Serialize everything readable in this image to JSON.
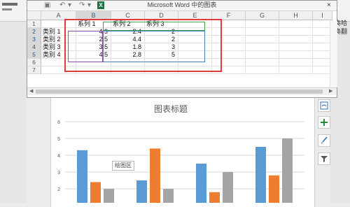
{
  "window": {
    "title": "Microsoft Word 中的图表",
    "close_glyph": "×",
    "qa_save": "▣",
    "qa_undo": "↶",
    "qa_redo": "↷",
    "qa_dropdown": "▾",
    "excel_badge": "X"
  },
  "sheet": {
    "columns": [
      "A",
      "B",
      "C",
      "D",
      "E",
      "F",
      "G",
      "H",
      "I"
    ],
    "rows": [
      "1",
      "2",
      "3",
      "4",
      "5",
      "6",
      "7"
    ],
    "selected_columns": [
      "B"
    ],
    "selected_rows": [
      "2",
      "3",
      "4",
      "5"
    ],
    "header_row": [
      "",
      "系列 1",
      "系列 2",
      "系列 3"
    ],
    "data_rows": [
      {
        "label": "类别 1",
        "values": [
          "4.3",
          "2.4",
          "2"
        ]
      },
      {
        "label": "类别 2",
        "values": [
          "2.5",
          "4.4",
          "2"
        ]
      },
      {
        "label": "类别 3",
        "values": [
          "3.5",
          "1.8",
          "3"
        ]
      },
      {
        "label": "类别 4",
        "values": [
          "4.5",
          "2.8",
          "5"
        ]
      }
    ]
  },
  "right_panel": {
    "text_line1": "奏哈",
    "text_line2": "奏翻"
  },
  "chart_tools": {
    "layout_icon": "chart-layout-icon",
    "add_icon": "plus-icon",
    "style_icon": "brush-icon",
    "filter_icon": "filter-icon"
  },
  "tooltip": "绘图区",
  "chart_data": {
    "type": "bar",
    "title": "图表标题",
    "categories": [
      "类别 1",
      "类别 2",
      "类别 3",
      "类别 4"
    ],
    "series": [
      {
        "name": "系列 1",
        "values": [
          4.3,
          2.5,
          3.5,
          4.5
        ],
        "color": "#5b9bd5"
      },
      {
        "name": "系列 2",
        "values": [
          2.4,
          4.4,
          1.8,
          2.8
        ],
        "color": "#ed7d31"
      },
      {
        "name": "系列 3",
        "values": [
          2,
          2,
          3,
          5
        ],
        "color": "#a5a5a5"
      }
    ],
    "ylim": [
      0,
      6
    ],
    "yticks": [
      2,
      3,
      4,
      5,
      6
    ],
    "grid": true
  }
}
